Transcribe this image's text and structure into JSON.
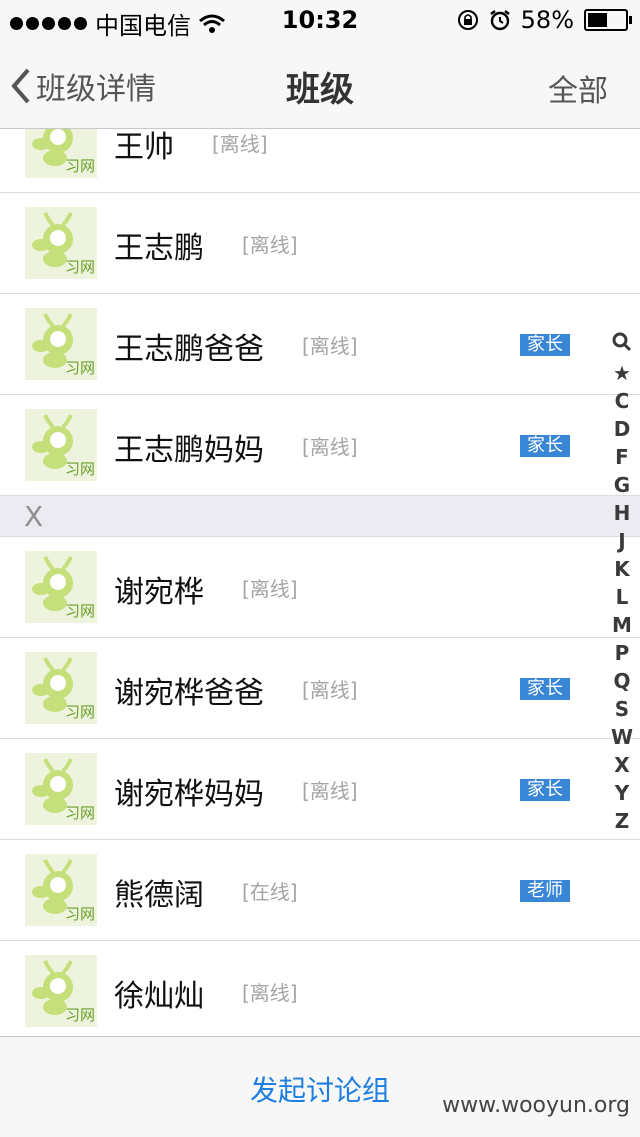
{
  "status_bar": {
    "carrier": "中国电信",
    "time": "10:32",
    "battery_percent": "58%",
    "battery_level": 0.58,
    "icons": [
      "signal-dots-icon",
      "wifi-icon",
      "rotation-lock-icon",
      "alarm-icon",
      "battery-icon"
    ]
  },
  "nav": {
    "back_label": "班级详情",
    "title": "班级",
    "right_label": "全部"
  },
  "avatar_brand": "习网",
  "rows": [
    {
      "name": "王帅",
      "status": "[离线]",
      "role": ""
    },
    {
      "name": "王志鹏",
      "status": "[离线]",
      "role": ""
    },
    {
      "name": "王志鹏爸爸",
      "status": "[离线]",
      "role": "家长"
    },
    {
      "name": "王志鹏妈妈",
      "status": "[离线]",
      "role": "家长"
    },
    {
      "section": "X"
    },
    {
      "name": "谢宛桦",
      "status": "[离线]",
      "role": ""
    },
    {
      "name": "谢宛桦爸爸",
      "status": "[离线]",
      "role": "家长"
    },
    {
      "name": "谢宛桦妈妈",
      "status": "[离线]",
      "role": "家长"
    },
    {
      "name": "熊德阔",
      "status": "[在线]",
      "role": "老师"
    },
    {
      "name": "徐灿灿",
      "status": "[离线]",
      "role": ""
    }
  ],
  "index": [
    "search",
    "★",
    "C",
    "D",
    "F",
    "G",
    "H",
    "J",
    "K",
    "L",
    "M",
    "P",
    "Q",
    "S",
    "W",
    "X",
    "Y",
    "Z"
  ],
  "bottom": {
    "action_label": "发起讨论组",
    "watermark": "www.wooyun.org"
  },
  "colors": {
    "role_badge": "#3a86d6",
    "link_blue": "#1e7fe0",
    "avatar_bg": "#eef3dd",
    "avatar_green": "#c5e07a"
  }
}
